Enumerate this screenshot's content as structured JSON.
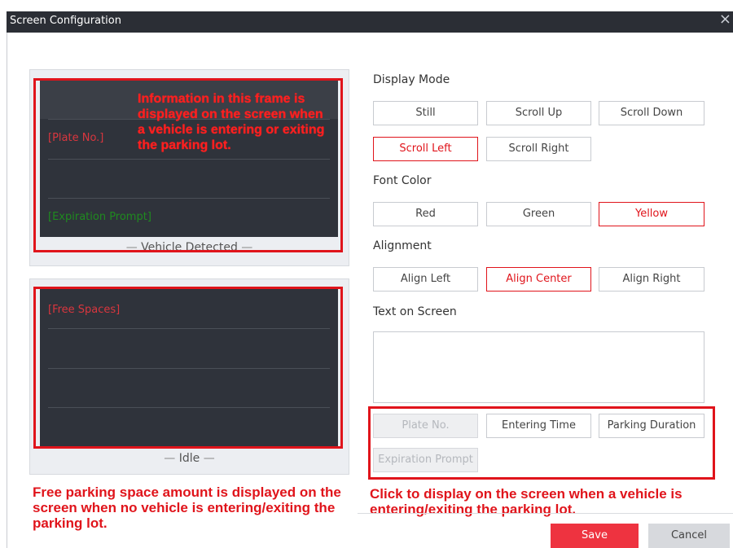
{
  "window": {
    "title": "Screen Configuration",
    "close_glyph": "×"
  },
  "vehicle_panel": {
    "label": "Vehicle Detected",
    "plate_tag": "[Plate No.]",
    "expiration_tag": "[Expiration Prompt]",
    "overlay_note": "Information in this frame is displayed on the screen when a vehicle is entering or exiting the parking lot."
  },
  "idle_panel": {
    "label": "Idle",
    "free_tag": "[Free Spaces]",
    "note": "Free parking space amount is displayed on the screen when no vehicle is entering/exiting the parking lot."
  },
  "display_mode": {
    "label": "Display Mode",
    "options": [
      "Still",
      "Scroll Up",
      "Scroll Down",
      "Scroll Left",
      "Scroll Right"
    ],
    "selected": "Scroll Left"
  },
  "font_color": {
    "label": "Font Color",
    "options": [
      "Red",
      "Green",
      "Yellow"
    ],
    "selected": "Yellow"
  },
  "alignment": {
    "label": "Alignment",
    "options": [
      "Align Left",
      "Align Center",
      "Align Right"
    ],
    "selected": "Align Center"
  },
  "text_on_screen": {
    "label": "Text on Screen",
    "value": ""
  },
  "insert_buttons": {
    "plate": "Plate No.",
    "entering_time": "Entering Time",
    "parking_duration": "Parking Duration",
    "expiration_prompt": "Expiration Prompt",
    "note": "Click to display on the screen when a vehicle is entering/exiting the parking lot."
  },
  "footer": {
    "save": "Save",
    "cancel": "Cancel"
  },
  "colors": {
    "accent_red": "#e0141b",
    "save_bg": "#ee3340",
    "plate_tag": "#d9363e",
    "expiration_tag": "#1f8a1f",
    "title_bar": "#2b2e35",
    "screen_bg": "#2f333b"
  }
}
